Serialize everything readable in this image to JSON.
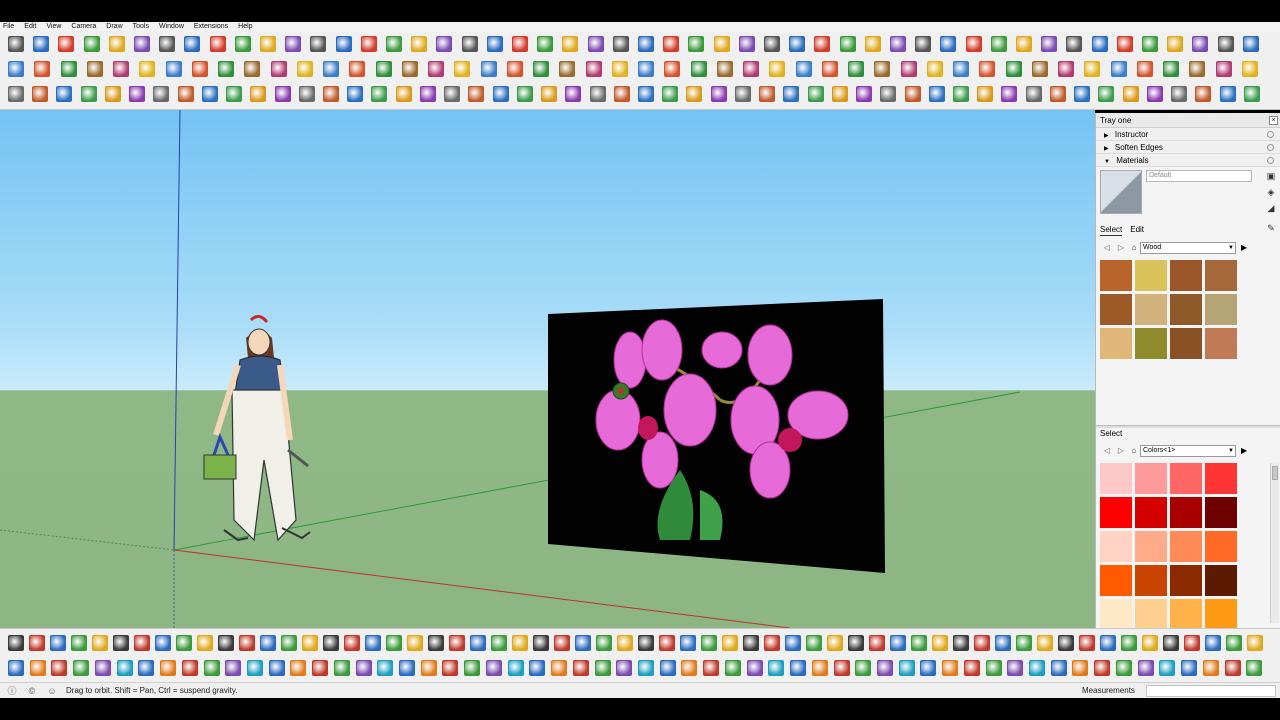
{
  "menu": [
    "File",
    "Edit",
    "View",
    "Camera",
    "Draw",
    "Tools",
    "Window",
    "Extensions",
    "Help"
  ],
  "toolbar_rows": [
    {
      "count": 50,
      "colors": [
        "#555555",
        "#2a6bbf",
        "#d33b2a",
        "#3b9a3a",
        "#e0a81c",
        "#7a4bb0"
      ]
    },
    {
      "count": 48,
      "colors": [
        "#3a7dc9",
        "#d4532a",
        "#2f8f3a",
        "#9a6a2b",
        "#b23a6f",
        "#e0b21c"
      ]
    },
    {
      "count": 52,
      "colors": [
        "#6a6a6a",
        "#c05a2a",
        "#2a70c0",
        "#3c9c4c",
        "#d99a1c",
        "#8a3ab0"
      ]
    }
  ],
  "bottom_toolbar_rows": [
    {
      "count": 60,
      "colors": [
        "#3a3a3a",
        "#c0392b",
        "#2a6bbf",
        "#3b9a3a",
        "#e0a81c"
      ]
    },
    {
      "count": 58,
      "colors": [
        "#2a6bbf",
        "#e07b1c",
        "#c0392b",
        "#3b9a3a",
        "#7a4bb0",
        "#1c9ec0"
      ]
    }
  ],
  "tray": {
    "title": "Tray one",
    "close_glyph": "×",
    "sections": [
      {
        "label": "Instructor",
        "expanded": false
      },
      {
        "label": "Soften Edges",
        "expanded": false
      },
      {
        "label": "Materials",
        "expanded": true
      }
    ],
    "material_name": "Default",
    "tabs": [
      "Select",
      "Edit"
    ],
    "library_top": "Wood",
    "wood_swatches": [
      "#b8642a",
      "#d9c35a",
      "#9a5528",
      "#a5683a",
      "#9c5a26",
      "#d2b27c",
      "#8f5a2a",
      "#b5a574",
      "#e0b778",
      "#8f8a2c",
      "#8a5125",
      "#c07a55"
    ],
    "select_label": "Select",
    "library_bottom": "Colors<1>",
    "color_swatches": [
      "#ffc8c8",
      "#ff9a9a",
      "#ff6666",
      "#ff3535",
      "#ff0000",
      "#d40000",
      "#a80000",
      "#6e0000",
      "#ffd3c3",
      "#ffab8a",
      "#ff8a55",
      "#ff6a26",
      "#ff5a00",
      "#c84400",
      "#8a2a00",
      "#5c1a00",
      "#ffe8c8",
      "#ffcf8f",
      "#ffb14a",
      "#ff9a14"
    ]
  },
  "status": {
    "message": "Drag to orbit. Shift = Pan, Ctrl = suspend gravity.",
    "measurements_label": "Measurements",
    "icons": [
      "info-icon",
      "copyright-icon",
      "user-icon"
    ]
  }
}
